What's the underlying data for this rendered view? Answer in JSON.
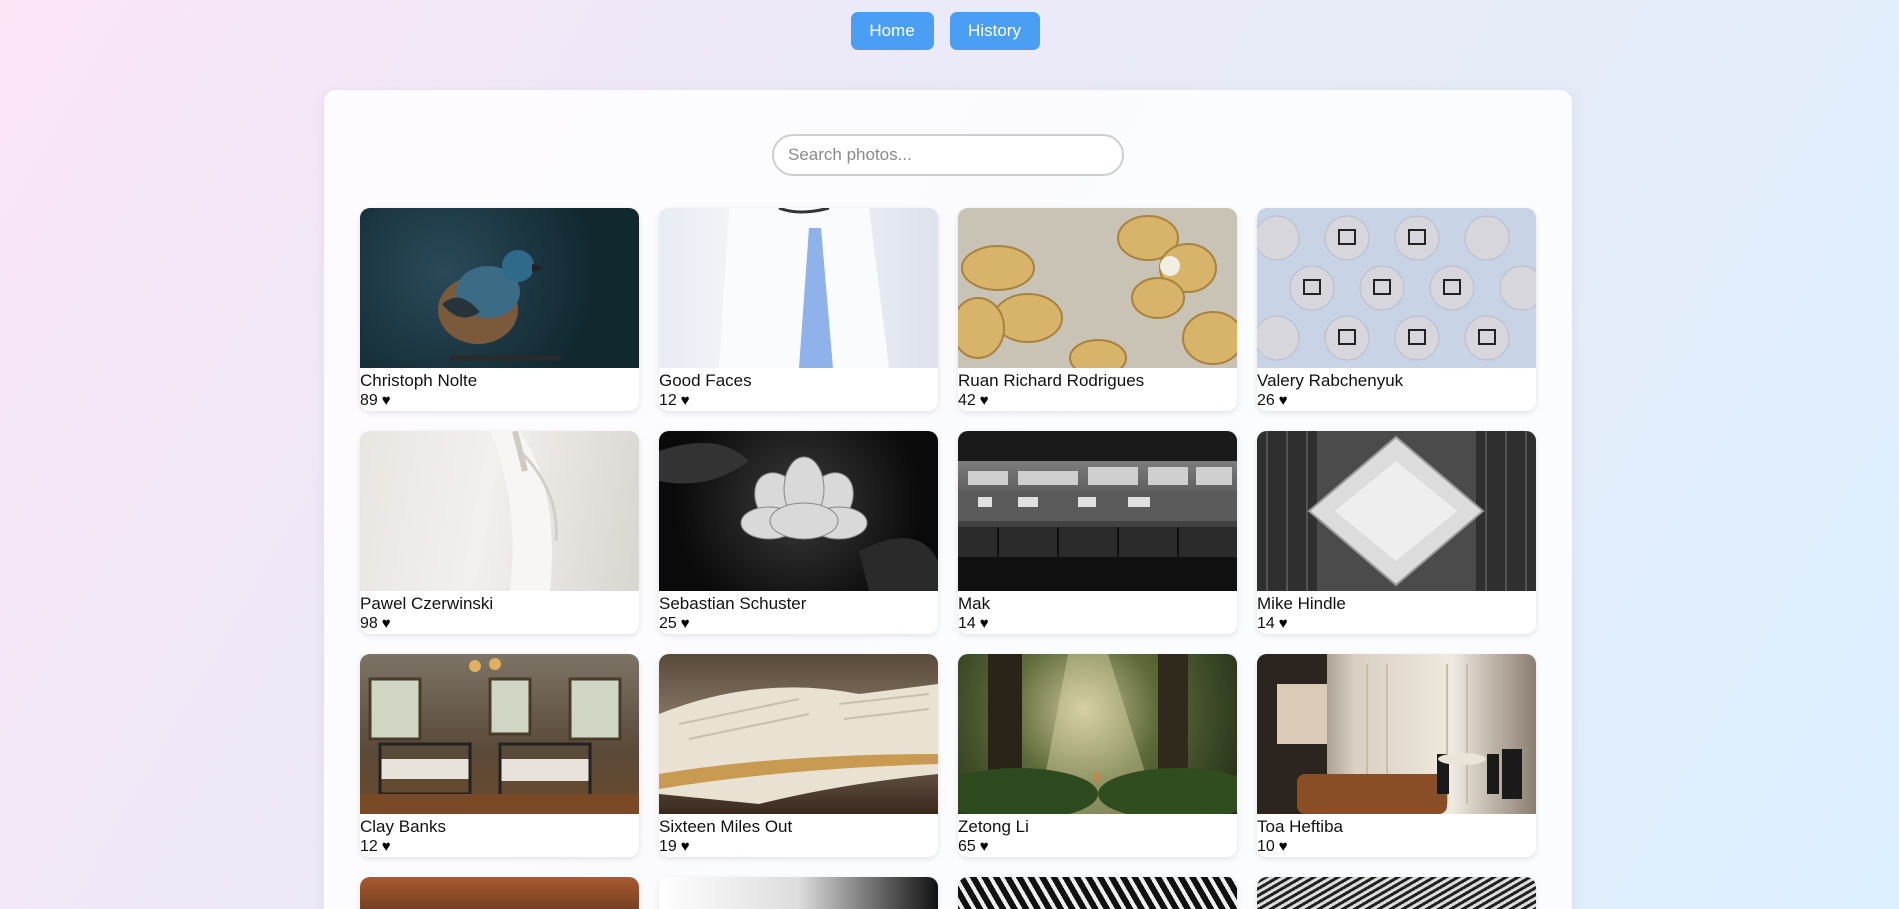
{
  "nav": {
    "home_label": "Home",
    "history_label": "History"
  },
  "search": {
    "placeholder": "Search photos...",
    "value": ""
  },
  "photos": [
    {
      "author": "Christoph Nolte",
      "likes": "89"
    },
    {
      "author": "Good Faces",
      "likes": "12"
    },
    {
      "author": "Ruan Richard Rodrigues",
      "likes": "42"
    },
    {
      "author": "Valery Rabchenyuk",
      "likes": "26"
    },
    {
      "author": "Pawel Czerwinski",
      "likes": "98"
    },
    {
      "author": "Sebastian Schuster",
      "likes": "25"
    },
    {
      "author": "Mak",
      "likes": "14"
    },
    {
      "author": "Mike Hindle",
      "likes": "14"
    },
    {
      "author": "Clay Banks",
      "likes": "12"
    },
    {
      "author": "Sixteen Miles Out",
      "likes": "19"
    },
    {
      "author": "Zetong Li",
      "likes": "65"
    },
    {
      "author": "Toa Heftiba",
      "likes": "10"
    }
  ],
  "colors": {
    "accent": "#4a9ff5"
  },
  "icons": {
    "like": "heart-icon"
  }
}
